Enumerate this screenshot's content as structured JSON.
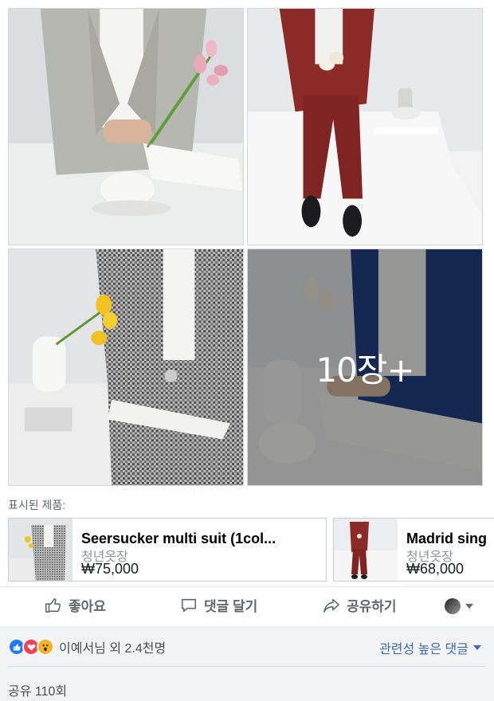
{
  "photos": [
    {
      "label": "photo-1"
    },
    {
      "label": "photo-2"
    },
    {
      "label": "photo-3"
    },
    {
      "label": "photo-4"
    }
  ],
  "more_photos_label": "10장+",
  "tagged_products_label": "표시된 제품:",
  "products": [
    {
      "name": "Seersucker multi suit (1col...",
      "shop": "청년옷장",
      "price": "₩75,000"
    },
    {
      "name": "Madrid sing",
      "shop": "청년옷장",
      "price": "₩68,000"
    }
  ],
  "actions": {
    "like": "좋아요",
    "comment": "댓글 달기",
    "share": "공유하기"
  },
  "reactions": {
    "summary": "이예서님 외 2.4천명",
    "icons": [
      "like-icon",
      "love-icon",
      "wow-icon"
    ]
  },
  "comment_sort": "관련성 높은 댓글",
  "shares": "공유 110회",
  "colors": {
    "link": "#4267b2",
    "like": "#2078f4",
    "love": "#f33e58",
    "wow": "#f7b125"
  }
}
